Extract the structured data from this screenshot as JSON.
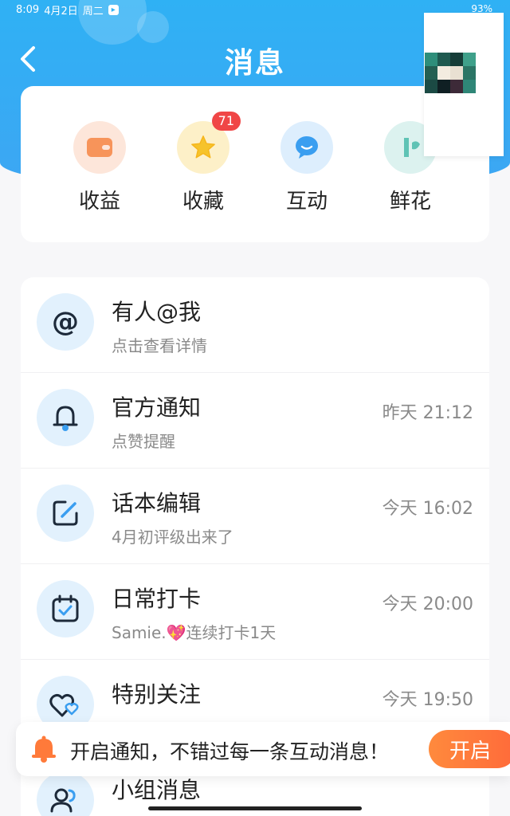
{
  "status_bar": {
    "time": "8:09",
    "date": "4月2日",
    "weekday": "周二",
    "battery": "93%"
  },
  "header": {
    "title": "消息"
  },
  "quick_actions": [
    {
      "label": "收益",
      "icon": "wallet-icon",
      "color": "#f7945a",
      "bg": "#fde6da"
    },
    {
      "label": "收藏",
      "icon": "star-icon",
      "color": "#f6c32b",
      "bg": "#fdf0c8",
      "badge": "71"
    },
    {
      "label": "互动",
      "icon": "chat-bubble-icon",
      "color": "#3a9ef0",
      "bg": "#ddeefd"
    },
    {
      "label": "鲜花",
      "icon": "flower-icon",
      "color": "#5fc3b5",
      "bg": "#dcf2ef"
    }
  ],
  "messages": [
    {
      "title": "有人@我",
      "subtitle": "点击查看详情",
      "time": "",
      "icon": "at-icon"
    },
    {
      "title": "官方通知",
      "subtitle": "点赞提醒",
      "time": "昨天 21:12",
      "icon": "bell-icon"
    },
    {
      "title": "话本编辑",
      "subtitle": "4月初评级出来了",
      "time": "今天 16:02",
      "icon": "edit-icon"
    },
    {
      "title": "日常打卡",
      "subtitle": "Samie.💖连续打卡1天",
      "time": "今天 20:00",
      "icon": "calendar-check-icon"
    },
    {
      "title": "特别关注",
      "subtitle": "",
      "time": "今天 19:50",
      "icon": "hearts-icon"
    },
    {
      "title": "小组消息",
      "subtitle": "",
      "time": "",
      "icon": "group-icon"
    }
  ],
  "notification_prompt": {
    "text": "开启通知，不错过每一条互动消息！",
    "button_label": "开启"
  },
  "colors": {
    "accent_blue": "#2fb1f4",
    "orange": "#ff7a3a",
    "badge_red": "#f04646"
  }
}
